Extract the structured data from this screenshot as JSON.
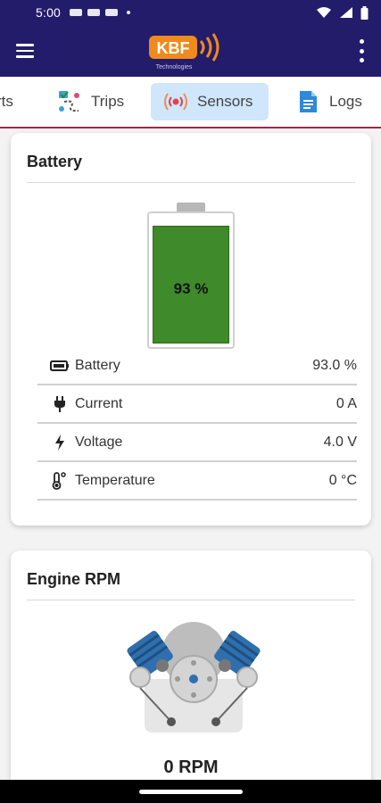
{
  "status_bar": {
    "time": "5:00"
  },
  "app": {
    "logo_text": "KBF",
    "logo_subtext": "Technologies"
  },
  "tabs": [
    {
      "label": "rts",
      "icon": "reports-icon"
    },
    {
      "label": "Trips",
      "icon": "trips-icon"
    },
    {
      "label": "Sensors",
      "icon": "sensors-icon",
      "active": true
    },
    {
      "label": "Logs",
      "icon": "logs-icon"
    }
  ],
  "battery_card": {
    "title": "Battery",
    "percent_label": "93 %",
    "level_fraction": 0.93,
    "rows": [
      {
        "icon": "battery-icon",
        "label": "Battery",
        "value": "93.0 %"
      },
      {
        "icon": "plug-icon",
        "label": "Current",
        "value": "0 A"
      },
      {
        "icon": "lightning-icon",
        "label": "Voltage",
        "value": "4.0 V"
      },
      {
        "icon": "thermometer-icon",
        "label": "Temperature",
        "value": "0 °C"
      }
    ]
  },
  "engine_card": {
    "title": "Engine RPM",
    "rpm_label": "0 RPM"
  },
  "colors": {
    "app_bar": "#231c6b",
    "active_tab": "#cfe6fb",
    "battery_fill": "#3f8a2a",
    "tab_underline": "#9c2a4a"
  }
}
